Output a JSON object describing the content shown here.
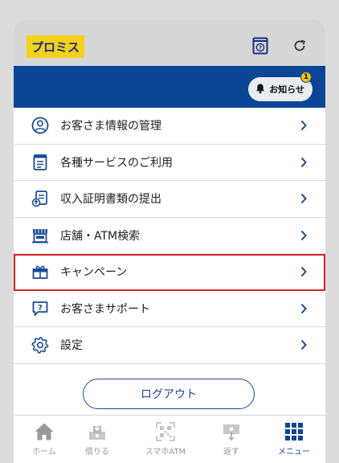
{
  "header": {
    "logo_text": "プロミス",
    "icons": [
      "faq-icon",
      "refresh-icon"
    ]
  },
  "notice": {
    "label": "お知らせ",
    "count": "1"
  },
  "menu": {
    "items": [
      {
        "label": "お客さま情報の管理",
        "icon": "user-circle-icon"
      },
      {
        "label": "各種サービスのご利用",
        "icon": "document-icon"
      },
      {
        "label": "収入証明書類の提出",
        "icon": "upload-document-icon"
      },
      {
        "label": "店舗・ATM検索",
        "icon": "store-icon"
      },
      {
        "label": "キャンペーン",
        "icon": "gift-icon"
      },
      {
        "label": "お客さまサポート",
        "icon": "help-chat-icon"
      },
      {
        "label": "設定",
        "icon": "gear-icon"
      }
    ]
  },
  "logout": {
    "label": "ログアウト"
  },
  "tabs": [
    {
      "label": "ホーム",
      "icon": "home-icon",
      "active": false
    },
    {
      "label": "借りる",
      "icon": "borrow-icon",
      "active": false
    },
    {
      "label": "スマホATM",
      "icon": "qr-icon",
      "active": false
    },
    {
      "label": "返す",
      "icon": "repay-icon",
      "active": false
    },
    {
      "label": "メニュー",
      "icon": "grid-menu-icon",
      "active": true
    }
  ],
  "colors": {
    "brand_blue": "#0a4596",
    "logo_yellow": "#f5d11a",
    "highlight_red": "#d32424",
    "header_gray": "#d6d6d6"
  }
}
